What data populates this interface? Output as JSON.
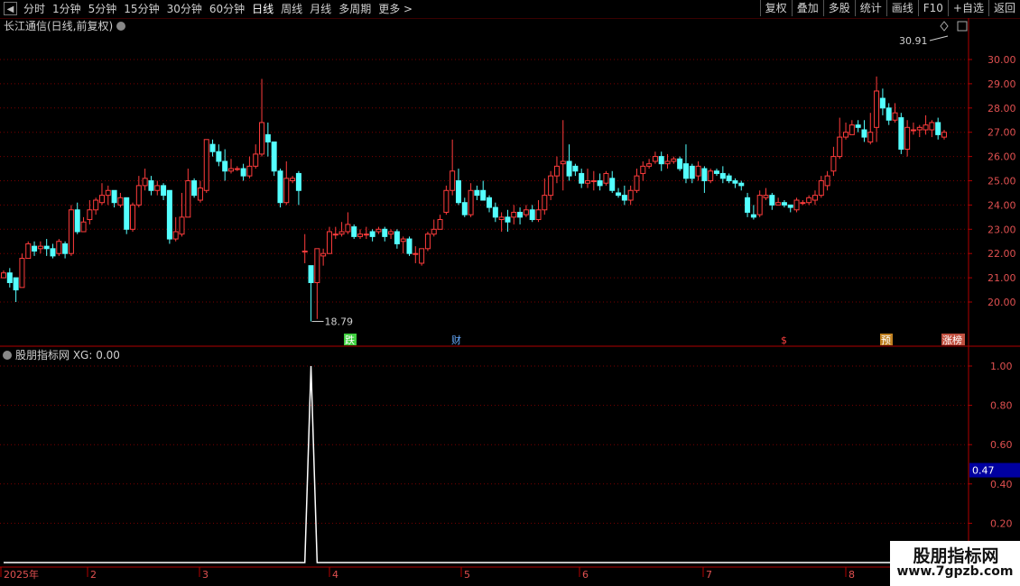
{
  "toolbar": {
    "periods": [
      "分时",
      "1分钟",
      "5分钟",
      "15分钟",
      "30分钟",
      "60分钟",
      "日线",
      "周线",
      "月线",
      "多周期",
      "更多 >"
    ],
    "active_period": "日线",
    "tools": [
      "复权",
      "叠加",
      "多股",
      "统计",
      "画线",
      "F10",
      "+自选",
      "返回"
    ]
  },
  "main_panel": {
    "title": "长江通信(日线,前复权)",
    "high_label": "30.91",
    "low_label": "18.79",
    "y_ticks": [
      "30.00",
      "29.00",
      "28.00",
      "27.00",
      "26.00",
      "25.00",
      "24.00",
      "23.00",
      "22.00",
      "21.00",
      "20.00"
    ],
    "markers": [
      "跌",
      "财",
      "$",
      "预",
      "涨榜"
    ]
  },
  "indicator_panel": {
    "title": "股朋指标网 XG: 0.00",
    "y_ticks": [
      "1.00",
      "0.80",
      "0.60",
      "0.40",
      "0.20"
    ],
    "cursor_value": "0.47"
  },
  "x_axis": {
    "labels": [
      "2025年",
      "2",
      "3",
      "4",
      "5",
      "6",
      "7",
      "8"
    ]
  },
  "watermark": {
    "line1": "股朋指标网",
    "line2": "www.7gpzb.com"
  },
  "colors": {
    "up": "#ff3c3c",
    "down": "#54ffff",
    "grid": "#7a0000",
    "axis": "#b00000",
    "cursor_box": "#0000a0"
  },
  "chart_data": {
    "type": "candlestick",
    "series_name": "长江通信",
    "ylim": [
      19.5,
      31
    ],
    "candles": [
      [
        21.0,
        21.2,
        21.0,
        21.3
      ],
      [
        21.2,
        20.8,
        20.6,
        21.4
      ],
      [
        21.0,
        20.5,
        20.0,
        21.0
      ],
      [
        20.6,
        21.8,
        20.6,
        22.0
      ],
      [
        21.8,
        22.4,
        21.8,
        22.5
      ],
      [
        22.3,
        22.1,
        21.9,
        22.5
      ],
      [
        22.2,
        22.3,
        22.0,
        22.5
      ],
      [
        22.3,
        22.2,
        21.9,
        22.6
      ],
      [
        22.2,
        21.9,
        21.8,
        22.4
      ],
      [
        22.0,
        22.5,
        21.9,
        22.6
      ],
      [
        22.4,
        22.0,
        21.8,
        22.5
      ],
      [
        22.0,
        23.8,
        21.9,
        24.0
      ],
      [
        23.8,
        22.9,
        22.8,
        24.1
      ],
      [
        22.9,
        23.3,
        22.9,
        23.5
      ],
      [
        23.4,
        23.8,
        23.2,
        24.2
      ],
      [
        23.8,
        24.2,
        23.6,
        24.3
      ],
      [
        24.1,
        24.4,
        24.0,
        24.9
      ],
      [
        24.4,
        24.6,
        24.0,
        24.8
      ],
      [
        24.6,
        24.1,
        23.9,
        24.6
      ],
      [
        24.0,
        24.3,
        23.9,
        24.5
      ],
      [
        24.3,
        23.0,
        22.8,
        24.3
      ],
      [
        23.0,
        24.0,
        22.9,
        24.1
      ],
      [
        24.0,
        24.8,
        23.9,
        25.2
      ],
      [
        24.8,
        25.1,
        24.6,
        25.5
      ],
      [
        25.0,
        24.6,
        24.4,
        25.2
      ],
      [
        24.6,
        24.8,
        24.4,
        25.0
      ],
      [
        24.8,
        24.4,
        24.2,
        24.9
      ],
      [
        24.6,
        22.6,
        22.4,
        24.6
      ],
      [
        22.6,
        22.9,
        22.5,
        23.5
      ],
      [
        22.8,
        23.5,
        22.7,
        24.5
      ],
      [
        23.5,
        25.0,
        23.5,
        25.5
      ],
      [
        25.0,
        24.4,
        24.3,
        25.1
      ],
      [
        24.2,
        24.7,
        24.1,
        25.0
      ],
      [
        24.6,
        26.7,
        24.5,
        26.7
      ],
      [
        26.5,
        26.2,
        26.0,
        26.7
      ],
      [
        26.2,
        25.8,
        25.6,
        26.5
      ],
      [
        25.8,
        25.4,
        25.0,
        26.3
      ],
      [
        25.4,
        25.5,
        25.3,
        25.9
      ],
      [
        25.5,
        25.5,
        25.4,
        25.6
      ],
      [
        25.5,
        25.2,
        25.0,
        25.7
      ],
      [
        25.2,
        25.6,
        25.1,
        26.0
      ],
      [
        25.6,
        26.1,
        25.5,
        26.5
      ],
      [
        26.1,
        27.4,
        26.0,
        29.2
      ],
      [
        26.9,
        26.6,
        26.0,
        27.4
      ],
      [
        26.6,
        25.4,
        25.2,
        26.6
      ],
      [
        25.4,
        24.1,
        23.9,
        25.5
      ],
      [
        24.1,
        25.1,
        24.0,
        25.8
      ],
      [
        25.0,
        25.1,
        24.9,
        25.2
      ],
      [
        25.3,
        24.6,
        24.0,
        25.4
      ],
      [
        22.1,
        22.1,
        21.6,
        22.8
      ],
      [
        21.5,
        20.8,
        19.2,
        21.5
      ],
      [
        20.8,
        22.2,
        19.3,
        22.2
      ],
      [
        21.9,
        22.0,
        21.5,
        22.2
      ],
      [
        22.0,
        22.9,
        22.0,
        23.1
      ],
      [
        22.8,
        22.8,
        22.6,
        23.1
      ],
      [
        22.8,
        22.9,
        22.7,
        23.3
      ],
      [
        22.9,
        23.2,
        22.8,
        23.7
      ],
      [
        23.1,
        22.7,
        22.6,
        23.2
      ],
      [
        22.7,
        22.8,
        22.6,
        23.0
      ],
      [
        22.8,
        22.8,
        22.6,
        23.1
      ],
      [
        22.9,
        22.7,
        22.5,
        23.0
      ],
      [
        22.9,
        23.0,
        22.8,
        23.1
      ],
      [
        23.0,
        22.7,
        22.5,
        23.1
      ],
      [
        22.8,
        22.9,
        22.6,
        23.0
      ],
      [
        22.9,
        22.4,
        22.2,
        23.0
      ],
      [
        22.5,
        22.6,
        22.0,
        22.7
      ],
      [
        22.6,
        22.0,
        21.9,
        22.7
      ],
      [
        22.0,
        22.0,
        21.6,
        22.3
      ],
      [
        21.6,
        22.2,
        21.5,
        22.2
      ],
      [
        22.2,
        22.8,
        22.1,
        22.9
      ],
      [
        22.8,
        23.0,
        22.7,
        23.4
      ],
      [
        23.0,
        23.4,
        23.0,
        23.6
      ],
      [
        23.7,
        24.6,
        23.6,
        24.8
      ],
      [
        24.6,
        25.4,
        24.4,
        26.7
      ],
      [
        25.0,
        24.1,
        24.0,
        25.5
      ],
      [
        24.1,
        23.6,
        23.5,
        24.3
      ],
      [
        23.6,
        24.6,
        23.5,
        24.9
      ],
      [
        24.6,
        24.4,
        24.2,
        24.8
      ],
      [
        24.6,
        24.2,
        24.2,
        25.0
      ],
      [
        24.3,
        23.9,
        23.7,
        24.4
      ],
      [
        23.9,
        23.5,
        23.3,
        24.1
      ],
      [
        23.4,
        23.5,
        22.9,
        23.7
      ],
      [
        23.5,
        23.3,
        22.9,
        23.8
      ],
      [
        23.5,
        23.7,
        23.2,
        24.0
      ],
      [
        23.7,
        23.5,
        23.2,
        23.9
      ],
      [
        23.6,
        23.8,
        23.5,
        24.0
      ],
      [
        23.8,
        23.4,
        23.3,
        24.0
      ],
      [
        23.4,
        23.8,
        23.3,
        24.2
      ],
      [
        23.8,
        24.4,
        23.6,
        25.1
      ],
      [
        24.4,
        25.2,
        24.2,
        25.4
      ],
      [
        25.2,
        25.6,
        24.9,
        26.0
      ],
      [
        25.7,
        25.8,
        24.6,
        27.5
      ],
      [
        25.8,
        25.2,
        25.0,
        26.5
      ],
      [
        25.6,
        25.4,
        25.2,
        25.7
      ],
      [
        25.3,
        24.9,
        24.7,
        25.5
      ],
      [
        24.9,
        25.0,
        24.7,
        25.5
      ],
      [
        25.0,
        25.0,
        24.6,
        25.4
      ],
      [
        25.0,
        24.8,
        24.6,
        25.3
      ],
      [
        24.9,
        25.3,
        24.8,
        25.4
      ],
      [
        25.1,
        24.6,
        24.5,
        25.4
      ],
      [
        24.5,
        24.4,
        24.3,
        24.7
      ],
      [
        24.4,
        24.2,
        24.0,
        24.8
      ],
      [
        24.2,
        24.6,
        24.0,
        24.8
      ],
      [
        24.6,
        25.2,
        24.5,
        25.5
      ],
      [
        25.3,
        25.6,
        25.0,
        25.8
      ],
      [
        25.6,
        25.7,
        25.5,
        25.9
      ],
      [
        25.8,
        26.0,
        25.7,
        26.2
      ],
      [
        26.0,
        25.7,
        25.4,
        26.2
      ],
      [
        25.7,
        25.8,
        25.5,
        26.1
      ],
      [
        25.8,
        25.9,
        25.7,
        26.0
      ],
      [
        25.9,
        25.5,
        25.4,
        26.0
      ],
      [
        25.7,
        25.1,
        24.9,
        26.5
      ],
      [
        25.6,
        25.1,
        24.9,
        25.7
      ],
      [
        25.2,
        25.6,
        25.0,
        25.8
      ],
      [
        25.5,
        25.0,
        24.5,
        25.6
      ],
      [
        25.0,
        25.4,
        24.9,
        25.5
      ],
      [
        25.4,
        25.3,
        25.2,
        25.5
      ],
      [
        25.3,
        25.1,
        24.9,
        25.6
      ],
      [
        25.2,
        25.0,
        24.9,
        25.3
      ],
      [
        25.0,
        24.9,
        24.7,
        25.1
      ],
      [
        24.9,
        24.8,
        24.6,
        25.0
      ],
      [
        24.3,
        23.7,
        23.5,
        24.5
      ],
      [
        23.6,
        23.5,
        23.4,
        24.0
      ],
      [
        23.6,
        24.4,
        23.5,
        24.6
      ],
      [
        24.3,
        24.4,
        24.2,
        24.7
      ],
      [
        24.4,
        24.0,
        23.8,
        24.5
      ],
      [
        24.0,
        24.1,
        24.0,
        24.3
      ],
      [
        24.1,
        24.0,
        23.9,
        24.2
      ],
      [
        24.0,
        23.9,
        23.7,
        24.0
      ],
      [
        23.8,
        24.2,
        23.7,
        24.3
      ],
      [
        24.1,
        24.1,
        24.0,
        24.2
      ],
      [
        24.1,
        24.3,
        24.0,
        24.4
      ],
      [
        24.2,
        24.4,
        24.0,
        24.6
      ],
      [
        24.4,
        25.0,
        24.3,
        25.2
      ],
      [
        24.8,
        25.2,
        24.6,
        25.4
      ],
      [
        25.4,
        26.0,
        25.2,
        26.4
      ],
      [
        26.0,
        26.8,
        25.9,
        27.6
      ],
      [
        26.8,
        27.0,
        26.7,
        27.4
      ],
      [
        26.9,
        27.3,
        26.9,
        27.5
      ],
      [
        27.3,
        27.2,
        27.0,
        27.5
      ],
      [
        27.1,
        26.8,
        26.6,
        27.5
      ],
      [
        26.6,
        27.0,
        26.5,
        27.8
      ],
      [
        27.2,
        28.7,
        26.6,
        29.3
      ],
      [
        28.4,
        28.0,
        27.7,
        28.8
      ],
      [
        28.0,
        27.5,
        27.3,
        28.2
      ],
      [
        27.5,
        27.8,
        27.4,
        28.2
      ],
      [
        27.6,
        26.3,
        26.1,
        27.8
      ],
      [
        26.3,
        27.2,
        26.0,
        27.5
      ],
      [
        27.1,
        27.1,
        26.9,
        27.4
      ],
      [
        27.1,
        27.2,
        26.8,
        27.3
      ],
      [
        27.1,
        27.3,
        26.9,
        27.7
      ],
      [
        27.1,
        27.4,
        26.8,
        27.5
      ],
      [
        27.4,
        26.9,
        26.7,
        27.6
      ],
      [
        26.8,
        27.0,
        26.7,
        27.1
      ]
    ],
    "xg_signal": {
      "index": 50,
      "value": 1.0,
      "other": 0.0
    },
    "indicator_ylim": [
      0,
      1.05
    ]
  }
}
